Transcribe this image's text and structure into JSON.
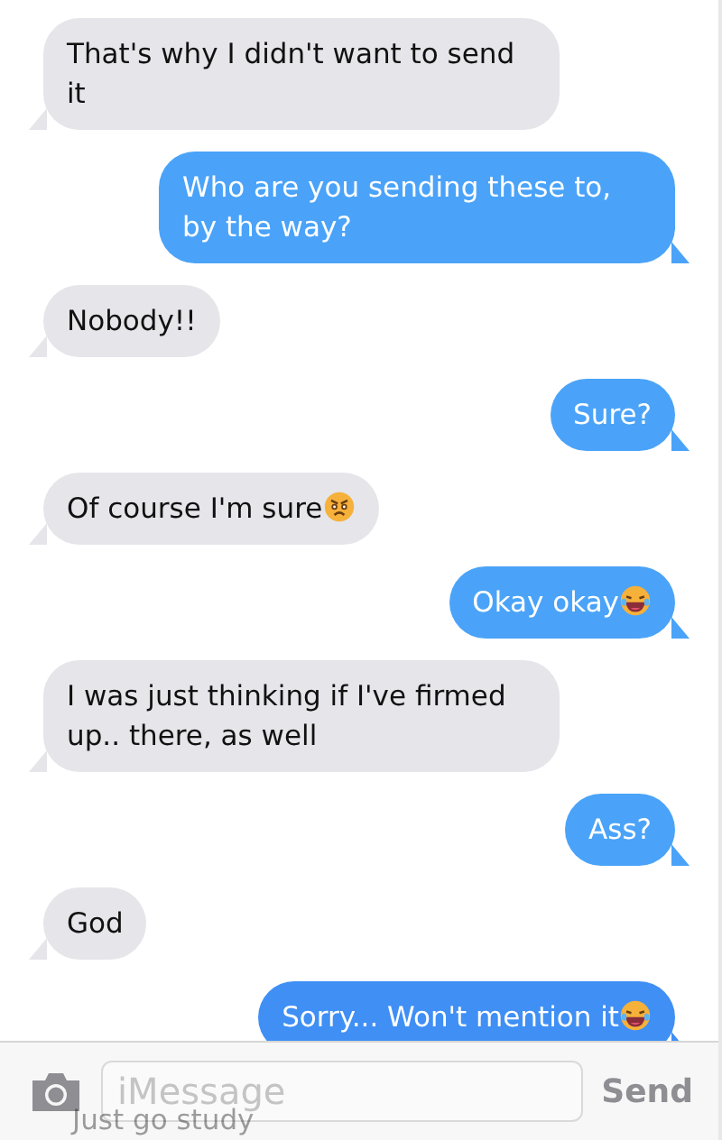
{
  "messages": [
    {
      "text": "That's why I didn't want to send it",
      "kind": "incoming"
    },
    {
      "text": "Who are you sending these to, by the way?",
      "kind": "outgoing"
    },
    {
      "text": "Nobody!!",
      "kind": "incoming"
    },
    {
      "text": "Sure?",
      "kind": "outgoing"
    },
    {
      "text": "Of course I'm sure",
      "kind": "incoming_angry"
    },
    {
      "text": "Okay okay",
      "kind": "outgoing_laughing"
    },
    {
      "text": "I was just thinking if I've firmed up.. there, as well",
      "kind": "incoming"
    },
    {
      "text": "Ass?",
      "kind": "outgoing"
    },
    {
      "text": "God",
      "kind": "incoming"
    },
    {
      "text": "Sorry... Won't mention it",
      "kind": "outgoing_laughing"
    }
  ],
  "behind_bar_text": "Just go study",
  "compose": {
    "placeholder": "iMessage",
    "send": "Send"
  }
}
